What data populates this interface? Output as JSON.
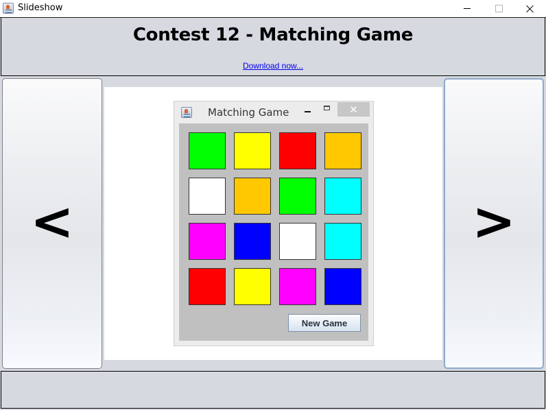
{
  "window": {
    "title": "Slideshow",
    "icon": "java-cup-icon",
    "controls": {
      "minimize": "minimize",
      "maximize": "maximize",
      "close": "close"
    }
  },
  "header": {
    "title": "Contest 12 - Matching Game",
    "link_text": "Download now..."
  },
  "nav": {
    "prev_label": "<",
    "next_label": ">"
  },
  "slide": {
    "game_window": {
      "title": "Matching Game",
      "icon": "java-cup-icon",
      "close_glyph": "✕",
      "tiles": [
        {
          "color": "#00ff00"
        },
        {
          "color": "#ffff00"
        },
        {
          "color": "#ff0000"
        },
        {
          "color": "#ffc800"
        },
        {
          "color": "#ffffff"
        },
        {
          "color": "#ffc800"
        },
        {
          "color": "#00ff00"
        },
        {
          "color": "#00ffff"
        },
        {
          "color": "#ff00ff"
        },
        {
          "color": "#0000ff"
        },
        {
          "color": "#ffffff"
        },
        {
          "color": "#00ffff"
        },
        {
          "color": "#ff0000"
        },
        {
          "color": "#ffff00"
        },
        {
          "color": "#ff00ff"
        },
        {
          "color": "#0000ff"
        }
      ],
      "new_game_label": "New Game"
    }
  },
  "footer": {
    "text": ""
  }
}
